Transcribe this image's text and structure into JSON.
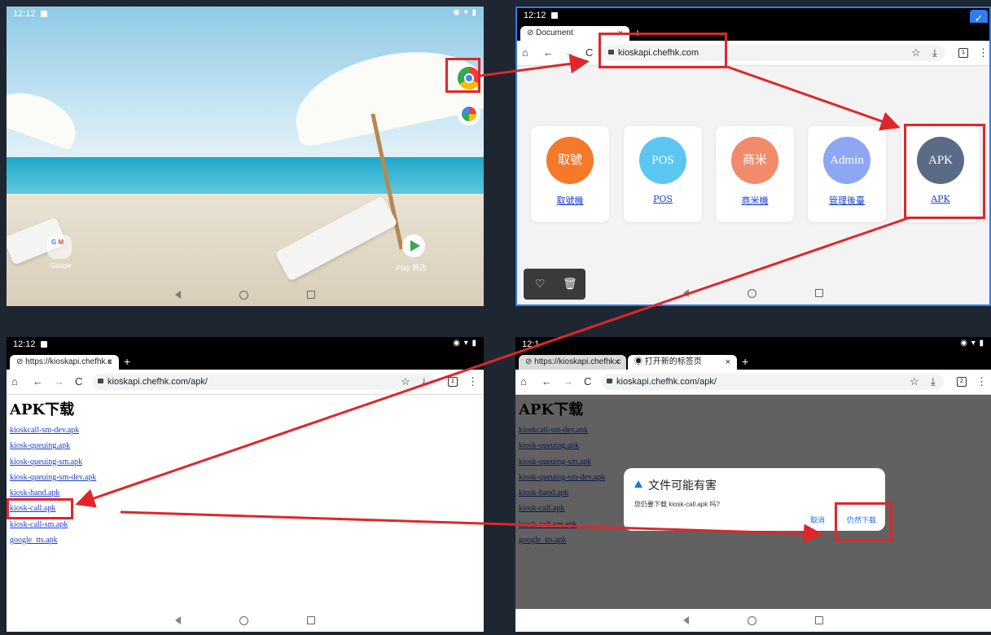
{
  "colors": {
    "annotation": "#e0262b",
    "link": "#1a3fd1",
    "frame_accent": "#2f7cf0"
  },
  "status": {
    "time": "12:12",
    "time_bottom_right": "12:1"
  },
  "home": {
    "icons": [
      "chrome-icon",
      "photos-icon",
      "play-store-icon",
      "google-folder-icon"
    ],
    "folder_label": "Google",
    "play_label": "Play 商店"
  },
  "browser_top": {
    "tab_title": "Document",
    "url": "kioskapi.chefhk.com",
    "cards": [
      {
        "circle": "取號",
        "link": "取號機",
        "color": "#f47a2a"
      },
      {
        "circle": "POS",
        "link": "POS",
        "color": "#5bc7f0"
      },
      {
        "circle": "商米",
        "link": "商米機",
        "color": "#f28a6c"
      },
      {
        "circle": "Admin",
        "link": "管理後臺",
        "color": "#8ea7f4"
      },
      {
        "circle": "APK",
        "link": "APK",
        "color": "#5b6b86"
      }
    ]
  },
  "browser_apk": {
    "tab_title": "https://kioskapi.chefhk.c",
    "url": "kioskapi.chefhk.com/apk/",
    "heading": "APK下载",
    "files": [
      "kioskcall-sm-dev.apk",
      "kiosk-queuing.apk",
      "kiosk-queuing-sm.apk",
      "kiosk-queuing-sm-dev.apk",
      "kiosk-hand.apk",
      "kiosk-call.apk",
      "kiosk-call-sm.apk",
      "google_tts.apk"
    ],
    "tab_count": "1"
  },
  "browser_dialog": {
    "tab1_title": "https://kioskapi.chefhk.c",
    "tab2_title": "打开新的标签页",
    "url": "kioskapi.chefhk.com/apk/",
    "tab_count": "2",
    "dialog": {
      "title": "文件可能有害",
      "message": "您仍要下载 kiosk-call.apk 吗?",
      "cancel": "取消",
      "confirm": "仍然下载"
    }
  }
}
